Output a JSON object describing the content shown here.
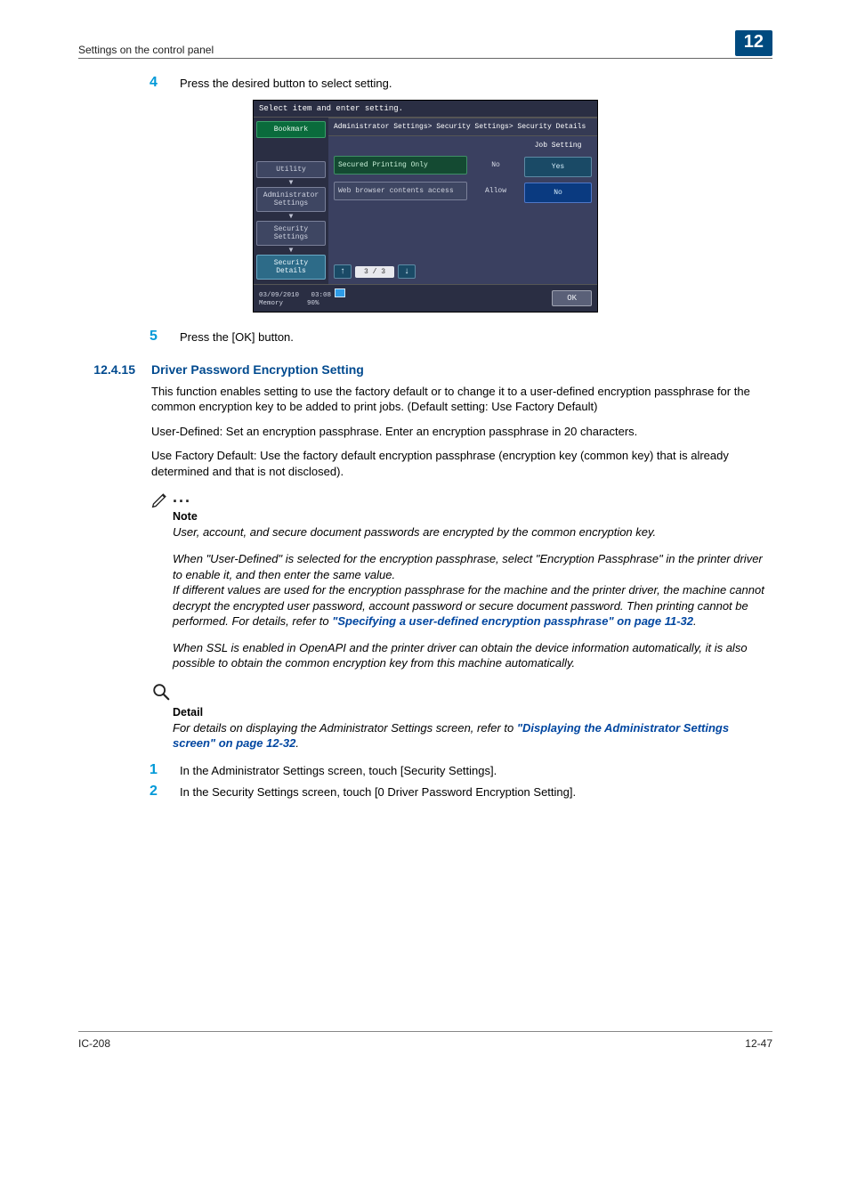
{
  "header": {
    "left": "Settings on the control panel",
    "chapter": "12"
  },
  "steps": {
    "s4": {
      "num": "4",
      "text": "Press the desired button to select setting."
    },
    "s5": {
      "num": "5",
      "text": "Press the [OK] button."
    },
    "s1b": {
      "num": "1",
      "text": "In the Administrator Settings screen, touch [Security Settings]."
    },
    "s2b": {
      "num": "2",
      "text": "In the Security Settings screen, touch [0 Driver Password Encryption Setting]."
    }
  },
  "panel": {
    "instruction": "Select item and enter setting.",
    "left": {
      "bookmark": "Bookmark",
      "utility": "Utility",
      "admin": "Administrator Settings",
      "security": "Security Settings",
      "details": "Security Details"
    },
    "breadcrumb": "Administrator Settings> Security Settings> Security Details",
    "side": {
      "head": "Job Setting",
      "yes": "Yes",
      "no": "No"
    },
    "rows": {
      "r1label": "Secured Printing Only",
      "r1val": "No",
      "r2label": "Web browser contents access",
      "r2val": "Allow"
    },
    "pager": {
      "mid": "3 / 3"
    },
    "footer": {
      "date": "03/09/2010",
      "time": "03:08",
      "memlabel": "Memory",
      "mempct": "90%",
      "ok": "OK"
    }
  },
  "section": {
    "num": "12.4.15",
    "title": "Driver Password Encryption Setting",
    "p1": "This function enables setting to use the factory default or to change it to a user-defined encryption passphrase for the common encryption key to be added to print jobs. (Default setting: Use Factory Default)",
    "p2": "User-Defined: Set an encryption passphrase. Enter an encryption passphrase in 20 characters.",
    "p3": "Use Factory Default: Use the factory default encryption passphrase (encryption key (common key) that is already determined and that is not disclosed)."
  },
  "note": {
    "head": "Note",
    "n1": "User, account, and secure document passwords are encrypted by the common encryption key.",
    "n2a": "When \"User-Defined\" is selected for the encryption passphrase, select \"Encryption Passphrase\" in the printer driver to enable it, and then enter the same value.",
    "n2b": "If different values are used for the encryption passphrase for the machine and the printer driver, the machine cannot decrypt the encrypted user password, account password or secure document password. Then printing cannot be performed. For details, refer to ",
    "n2link": "\"Specifying a user-defined encryption passphrase\" on page 11-32",
    "n2end": ".",
    "n3": "When SSL is enabled in OpenAPI and the printer driver can obtain the device information automatically, it is also possible to obtain the common encryption key from this machine automatically."
  },
  "detail": {
    "head": "Detail",
    "body": "For details on displaying the Administrator Settings screen, refer to ",
    "link": "\"Displaying the Administrator Settings screen\" on page 12-32",
    "end": "."
  },
  "footer": {
    "left": "IC-208",
    "right": "12-47"
  }
}
